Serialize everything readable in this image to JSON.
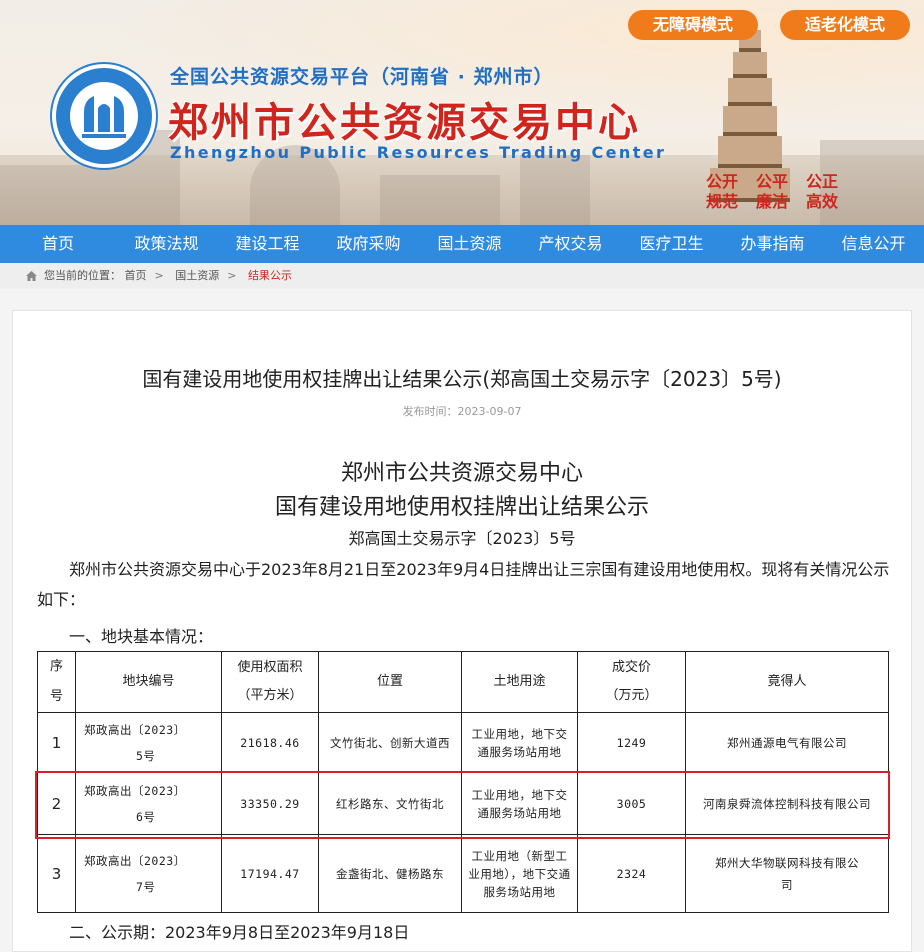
{
  "header": {
    "platform_line": "全国公共资源交易平台（河南省 · 郑州市）",
    "center_name": "郑州市公共资源交易中心",
    "center_name_en": "Zhengzhou Public Resources Trading Center",
    "accessibility_btn": "无障碍模式",
    "elderly_btn": "适老化模式",
    "slogans": [
      "公开",
      "公平",
      "公正",
      "规范",
      "廉洁",
      "高效"
    ],
    "accent_blue": "#2f8be0",
    "accent_red": "#d0251d",
    "accent_orange": "#f07b1b"
  },
  "nav": {
    "items": [
      "首页",
      "政策法规",
      "建设工程",
      "政府采购",
      "国土资源",
      "产权交易",
      "医疗卫生",
      "办事指南",
      "信息公开"
    ]
  },
  "breadcrumb": {
    "prefix": "您当前的位置：",
    "items": [
      "首页",
      "国土资源",
      "结果公示"
    ]
  },
  "article": {
    "title": "国有建设用地使用权挂牌出让结果公示(郑高国土交易示字〔2023〕5号)",
    "publish_time": "发布时间：2023-09-07",
    "org": "郑州市公共资源交易中心",
    "heading": "国有建设用地使用权挂牌出让结果公示",
    "doc_no": "郑高国土交易示字〔2023〕5号",
    "intro": "郑州市公共资源交易中心于2023年8月21日至2023年9月4日挂牌出让三宗国有建设用地使用权。现将有关情况公示如下：",
    "section1": "一、地块基本情况：",
    "section2": "二、公示期：2023年9月8日至2023年9月18日"
  },
  "table": {
    "headers": {
      "seq": "序号",
      "code": "地块编号",
      "area": "使用权面积",
      "area_unit": "（平方米）",
      "location": "位置",
      "usage": "土地用途",
      "price": "成交价",
      "price_unit": "（万元）",
      "winner": "竟得人"
    },
    "rows": [
      {
        "seq": "1",
        "code_a": "郑政高出〔2023〕",
        "code_b": "5号",
        "area": "21618.46",
        "location": "文竹街北、创新大道西",
        "usage": "工业用地，地下交通服务场站用地",
        "price": "1249",
        "winner": "郑州通源电气有限公司"
      },
      {
        "seq": "2",
        "code_a": "郑政高出〔2023〕",
        "code_b": "6号",
        "area": "33350.29",
        "location": "红杉路东、文竹街北",
        "usage": "工业用地，地下交通服务场站用地",
        "price": "3005",
        "winner": "河南泉舜流体控制科技有限公司"
      },
      {
        "seq": "3",
        "code_a": "郑政高出〔2023〕",
        "code_b": "7号",
        "area": "17194.47",
        "location": "金盏街北、健杨路东",
        "usage": "工业用地（新型工业用地），地下交通服务场站用地",
        "price": "2324",
        "winner": "郑州大华物联网科技有限公司"
      }
    ]
  }
}
